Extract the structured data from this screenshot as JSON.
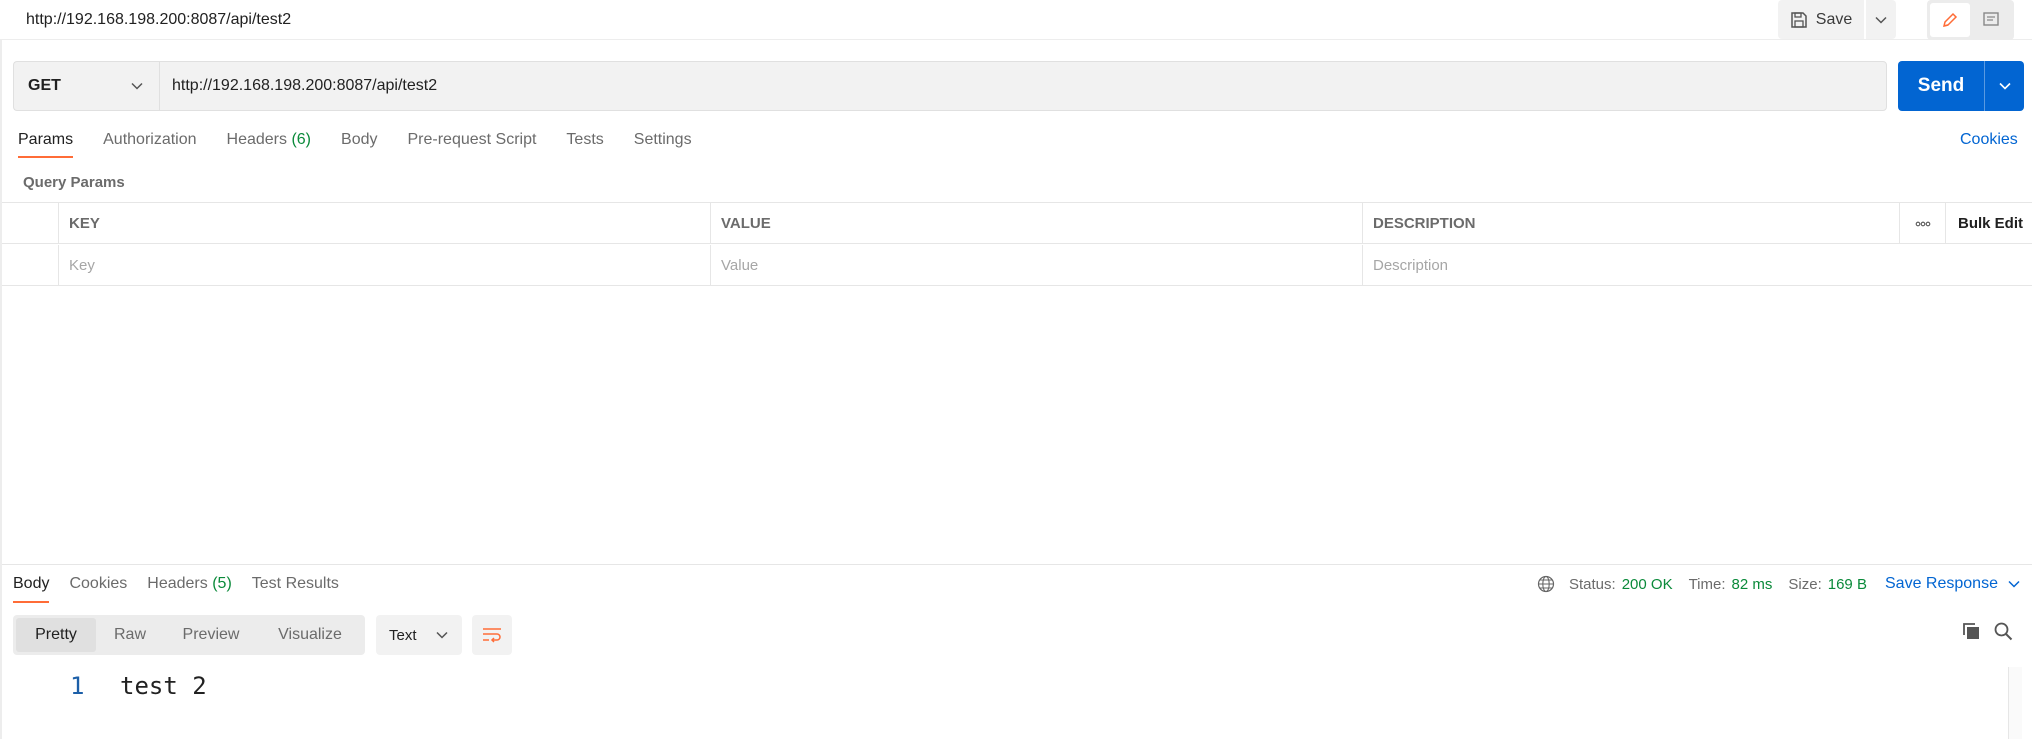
{
  "request": {
    "title": "http://192.168.198.200:8087/api/test2",
    "method": "GET",
    "url": "http://192.168.198.200:8087/api/test2"
  },
  "toolbar": {
    "save_label": "Save",
    "send_label": "Send"
  },
  "request_tabs": [
    {
      "label": "Params",
      "count": ""
    },
    {
      "label": "Authorization",
      "count": ""
    },
    {
      "label": "Headers",
      "count": "(6)"
    },
    {
      "label": "Body",
      "count": ""
    },
    {
      "label": "Pre-request Script",
      "count": ""
    },
    {
      "label": "Tests",
      "count": ""
    },
    {
      "label": "Settings",
      "count": ""
    }
  ],
  "cookies_label": "Cookies",
  "query_params": {
    "section_label": "Query Params",
    "headers": {
      "key": "KEY",
      "value": "VALUE",
      "description": "DESCRIPTION",
      "more": "ooo",
      "bulk_edit": "Bulk Edit"
    },
    "placeholders": {
      "key": "Key",
      "value": "Value",
      "description": "Description"
    }
  },
  "response": {
    "tabs": [
      {
        "label": "Body",
        "count": ""
      },
      {
        "label": "Cookies",
        "count": ""
      },
      {
        "label": "Headers",
        "count": "(5)"
      },
      {
        "label": "Test Results",
        "count": ""
      }
    ],
    "status_label": "Status:",
    "status_value": "200 OK",
    "time_label": "Time:",
    "time_value": "82 ms",
    "size_label": "Size:",
    "size_value": "169 B",
    "save_response_label": "Save Response",
    "view_modes": [
      "Pretty",
      "Raw",
      "Preview",
      "Visualize"
    ],
    "format": "Text",
    "lines": [
      {
        "num": "1",
        "text": "test 2"
      }
    ]
  },
  "colors": {
    "accent_orange": "#ff6c37",
    "link_blue": "#0265d2",
    "success_green": "#0a8a3a"
  },
  "icons": [
    "save-icon",
    "chevron-down-icon",
    "edit-pencil-icon",
    "comment-icon",
    "globe-icon",
    "wrap-lines-icon",
    "copy-icon",
    "search-icon"
  ]
}
